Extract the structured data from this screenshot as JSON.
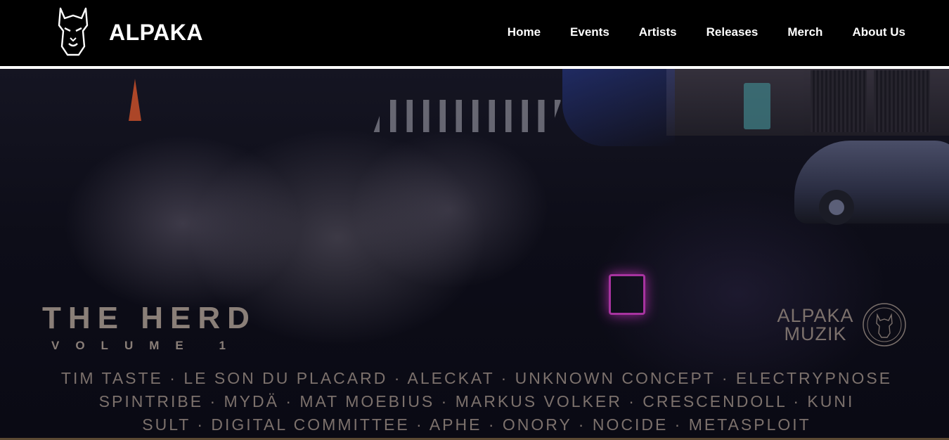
{
  "header": {
    "brand": "ALPAKA",
    "nav": [
      "Home",
      "Events",
      "Artists",
      "Releases",
      "Merch",
      "About Us"
    ]
  },
  "icons": {
    "logo": "alpaca-head-icon",
    "label": "alpaca-record-icon"
  },
  "hero": {
    "title": "THE HERD",
    "subtitle": "VOLUME 1",
    "label_line1": "ALPAKA",
    "label_line2": "MUZIK",
    "lineup": [
      "TIM TASTE · LE SON DU PLACARD · ALECKAT · UNKNOWN CONCEPT · ELECTRYPNOSE",
      "SPINTRIBE · MYDÄ · MAT MOEBIUS · MARKUS VOLKER · CRESCENDOLL · KUNI",
      "SULT · DIGITAL COMMITTEE · APHE · ONORY · NOCIDE · METASPLOIT"
    ]
  },
  "colors": {
    "header_bg": "#000000",
    "text_accent": "#8a7f78",
    "divider": "#ffffff"
  }
}
